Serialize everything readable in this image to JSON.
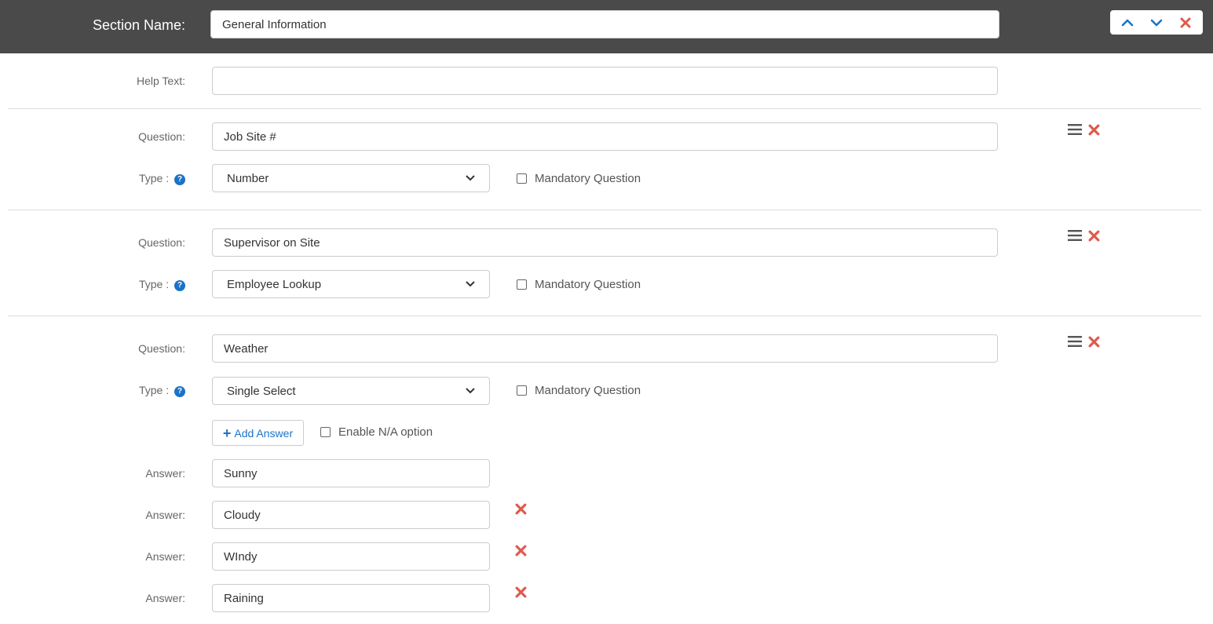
{
  "header": {
    "label": "Section Name:",
    "section_name_value": "General Information",
    "controls": [
      "chevron-up-icon",
      "chevron-down-icon",
      "close-icon"
    ]
  },
  "help": {
    "label": "Help Text:",
    "value": ""
  },
  "questions": [
    {
      "question_label": "Question:",
      "question_value": "Job Site #",
      "type_label": "Type :",
      "type_value": "Number",
      "mandatory_label": "Mandatory Question",
      "mandatory_checked": false
    },
    {
      "question_label": "Question:",
      "question_value": "Supervisor on Site",
      "type_label": "Type :",
      "type_value": "Employee Lookup",
      "mandatory_label": "Mandatory Question",
      "mandatory_checked": false
    },
    {
      "question_label": "Question:",
      "question_value": "Weather",
      "type_label": "Type :",
      "type_value": "Single Select",
      "mandatory_label": "Mandatory Question",
      "mandatory_checked": false,
      "add_answer_label": "Add Answer",
      "na_option_label": "Enable N/A option",
      "na_option_checked": false,
      "answers": [
        {
          "label": "Answer:",
          "value": "Sunny",
          "removable": false
        },
        {
          "label": "Answer:",
          "value": "Cloudy",
          "removable": true
        },
        {
          "label": "Answer:",
          "value": "WIndy",
          "removable": true
        },
        {
          "label": "Answer:",
          "value": "Raining",
          "removable": true
        }
      ]
    }
  ],
  "colors": {
    "header_bg": "#4a4a4a",
    "accent_blue": "#1a73c7",
    "delete_red": "#e05a4f"
  }
}
